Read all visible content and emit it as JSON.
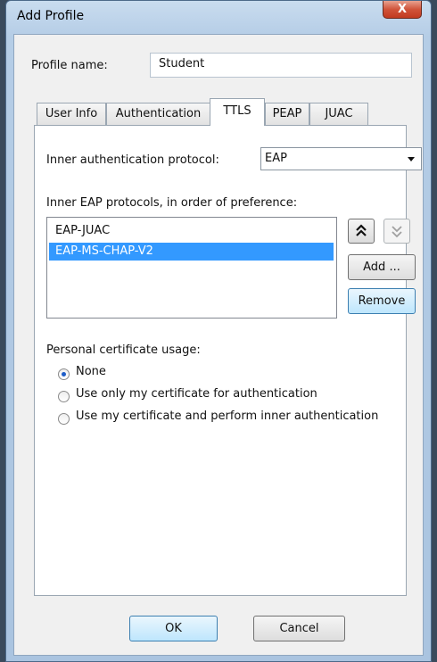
{
  "window": {
    "title": "Add Profile",
    "close_label": "X"
  },
  "profile": {
    "label": "Profile name:",
    "value": "Student"
  },
  "tabs": [
    {
      "label": "User Info"
    },
    {
      "label": "Authentication"
    },
    {
      "label": "TTLS",
      "active": true
    },
    {
      "label": "PEAP"
    },
    {
      "label": "JUAC"
    }
  ],
  "inner_auth": {
    "label": "Inner authentication protocol:",
    "selected": "EAP"
  },
  "eap_list": {
    "label": "Inner EAP protocols, in order of preference:",
    "items": [
      "EAP-JUAC",
      "EAP-MS-CHAP-V2"
    ],
    "selected_index": 1
  },
  "list_buttons": {
    "up_icon": "double-chevron-up-icon",
    "down_icon": "double-chevron-down-icon",
    "add": "Add ...",
    "remove": "Remove"
  },
  "cert_usage": {
    "label": "Personal certificate usage:",
    "options": [
      "None",
      "Use only my certificate for authentication",
      "Use my certificate and perform inner authentication"
    ],
    "selected_index": 0
  },
  "dialog_buttons": {
    "ok": "OK",
    "cancel": "Cancel"
  },
  "colors": {
    "selection": "#3399ff",
    "hot_button": "#bee6fd"
  }
}
